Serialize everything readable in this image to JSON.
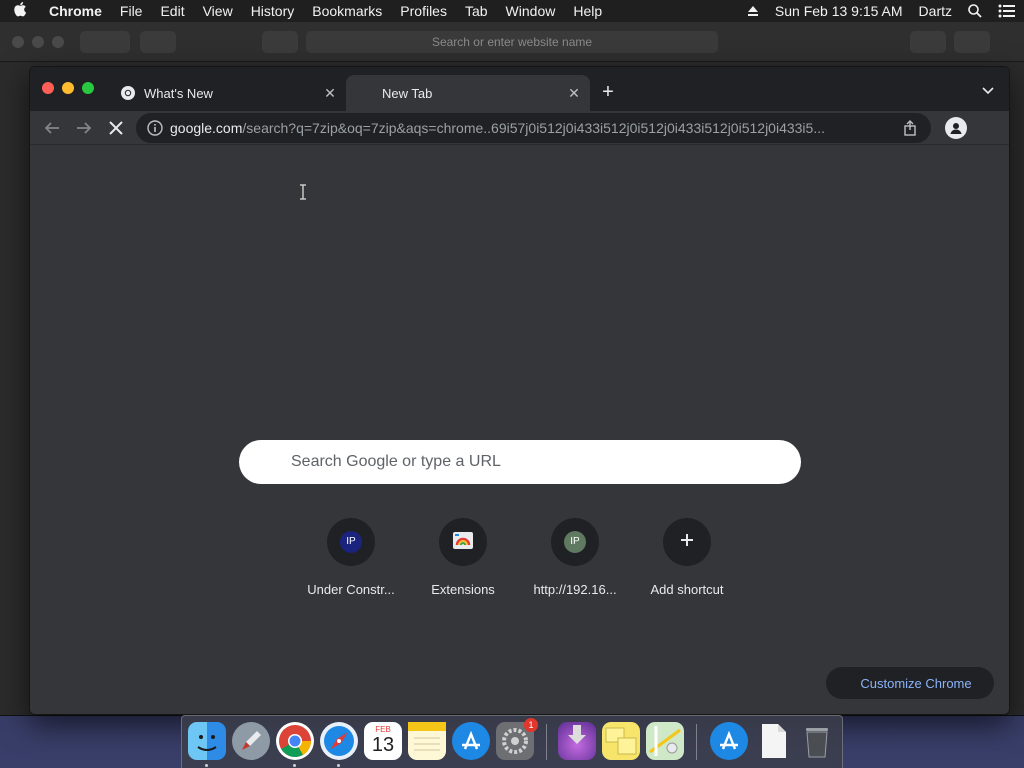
{
  "menubar": {
    "app_name": "Chrome",
    "items": [
      "File",
      "Edit",
      "View",
      "History",
      "Bookmarks",
      "Profiles",
      "Tab",
      "Window",
      "Help"
    ],
    "datetime": "Sun Feb 13  9:15 AM",
    "user": "Dartz"
  },
  "safari": {
    "address_placeholder": "Search or enter website name"
  },
  "chrome": {
    "tabs": [
      {
        "label": "What's New",
        "active": false
      },
      {
        "label": "New Tab",
        "active": true
      }
    ],
    "omnibox": {
      "host": "google.com",
      "path": "/search?q=7zip&oq=7zip&aqs=chrome..69i57j0i512j0i433i512j0i512j0i433i512j0i512j0i433i5..."
    },
    "search_placeholder": "Search Google or type a URL",
    "shortcuts": [
      {
        "title": "Under Constr...",
        "icon": "IP",
        "color": "#1a237e"
      },
      {
        "title": "Extensions",
        "icon": "extensions-icon"
      },
      {
        "title": "http://192.16...",
        "icon": "IP",
        "color": "#5f7a61"
      },
      {
        "title": "Add shortcut",
        "icon": "plus-icon"
      }
    ],
    "customize_label": "Customize Chrome"
  },
  "dock": {
    "apps": [
      "Finder",
      "Launchpad",
      "Google Chrome",
      "Safari",
      "Calendar",
      "Notes",
      "App Store",
      "System Preferences",
      "Downloads",
      "Stickies",
      "Maps",
      "App Store Folder",
      "Document",
      "Trash"
    ],
    "calendar_month": "FEB",
    "calendar_day": "13",
    "system_prefs_badge": "1"
  }
}
